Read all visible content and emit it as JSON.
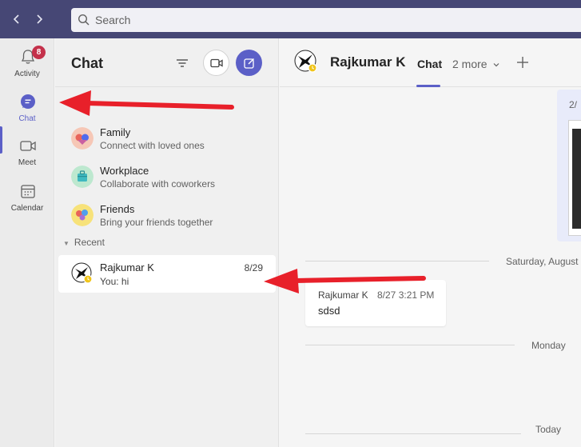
{
  "titlebar": {
    "search_placeholder": "Search"
  },
  "rail": {
    "items": [
      {
        "label": "Activity",
        "badge": "8"
      },
      {
        "label": "Chat"
      },
      {
        "label": "Meet"
      },
      {
        "label": "Calendar"
      }
    ],
    "active": "Chat"
  },
  "chat_list": {
    "title": "Chat",
    "communities": [
      {
        "name": "Family",
        "description": "Connect with loved ones"
      },
      {
        "name": "Workplace",
        "description": "Collaborate with coworkers"
      },
      {
        "name": "Friends",
        "description": "Bring your friends together"
      }
    ],
    "recent_label": "Recent",
    "recent_chats": [
      {
        "name": "Rajkumar K",
        "date": "8/29",
        "preview": "You: hi"
      }
    ]
  },
  "conversation": {
    "contact_name": "Rajkumar K",
    "tab_chat": "Chat",
    "more_tabs": "2 more",
    "image_message_date": "2/",
    "dividers": [
      "Saturday, August",
      "Monday",
      "Today"
    ],
    "message": {
      "author": "Rajkumar K",
      "time": "8/27 3:21 PM",
      "text": "sdsd"
    }
  },
  "colors": {
    "titlebar": "#464775",
    "accent": "#5b5fc7",
    "badge": "#c4314b",
    "annotation_arrow": "#e8202a"
  }
}
